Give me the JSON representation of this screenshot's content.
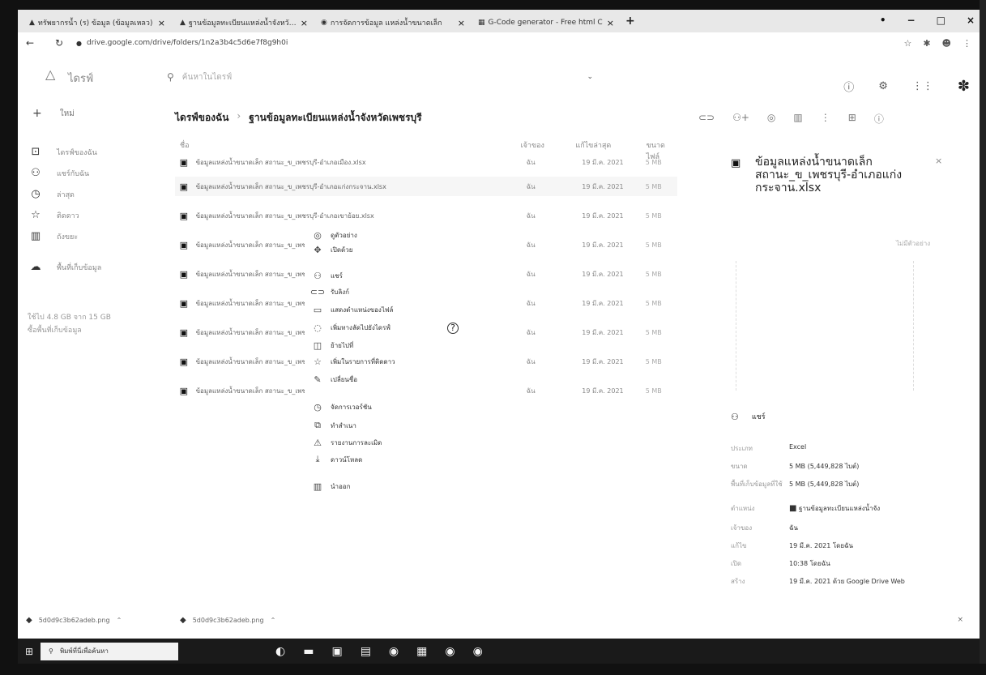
{
  "browser": {
    "tabs": [
      {
        "title": "ทรัพยากรน้ำ (ร) ข้อมูล (ข้อมูลเหลว)",
        "icon": "drive-icon"
      },
      {
        "title": "ฐานข้อมูลทะเบียนแหล่งน้ำจังหวัดเพชรบุรี",
        "icon": "drive-icon"
      },
      {
        "title": "การจัดการข้อมูล แหล่งน้ำขนาดเล็ก",
        "icon": "globe-icon"
      },
      {
        "title": "G-Code generator - Free html C",
        "icon": "sheet-icon"
      }
    ],
    "tab_close": "×",
    "new_tab": "+",
    "url": "drive.google.com/drive/folders/1n2a3b4c5d6e7f8g9h0i",
    "window_controls": [
      "•",
      "−",
      "□",
      "×"
    ]
  },
  "drive": {
    "logo_text": "ไดรฟ์",
    "search_placeholder": "ค้นหาในไดรฟ์",
    "search_options": "⌄",
    "header_icons": [
      "help-icon",
      "settings-icon",
      "apps-icon",
      "account-avatar-icon"
    ]
  },
  "leftnav": {
    "new_label": "ใหม่",
    "items": [
      {
        "label": "ไดรฟ์ของฉัน",
        "icon": "my-drive-icon"
      },
      {
        "label": "แชร์กับฉัน",
        "icon": "shared-icon"
      },
      {
        "label": "ล่าสุด",
        "icon": "recent-icon"
      },
      {
        "label": "ติดดาว",
        "icon": "starred-icon"
      },
      {
        "label": "ถังขยะ",
        "icon": "trash-icon"
      },
      {
        "label": "พื้นที่เก็บข้อมูล",
        "icon": "storage-icon"
      }
    ],
    "storage_used": "ใช้ไป 4.8 GB จาก 15 GB",
    "storage_buy": "ซื้อพื้นที่เก็บข้อมูล"
  },
  "breadcrumb": {
    "root": "ไดรฟ์ของฉัน",
    "sep": "›",
    "current": "ฐานข้อมูลทะเบียนแหล่งน้ำจังหวัดเพชรบุรี"
  },
  "toolbar_icons": [
    "link-icon",
    "add-person-icon",
    "preview-icon",
    "delete-icon",
    "more-icon",
    "grid-view-icon",
    "info-icon"
  ],
  "filelist": {
    "header": {
      "name": "ชื่อ",
      "owner": "เจ้าของ",
      "modified": "แก้ไขล่าสุด",
      "size": "ขนาดไฟล์"
    },
    "rows": [
      {
        "name": "ข้อมูลแหล่งน้ำขนาดเล็ก สถานะ_ข_เพชรบุรี-อำเภอเมือง.xlsx",
        "owner": "ฉัน",
        "modified": "19 มี.ค. 2021",
        "size": "5 MB"
      },
      {
        "name": "ข้อมูลแหล่งน้ำขนาดเล็ก สถานะ_ข_เพชรบุรี-อำเภอแก่งกระจาน.xlsx",
        "owner": "ฉัน",
        "modified": "19 มี.ค. 2021",
        "size": "5 MB"
      },
      {
        "name": "ข้อมูลแหล่งน้ำขนาดเล็ก สถานะ_ข_เพชรบุรี-อำเภอเขาย้อย.xlsx",
        "owner": "ฉัน",
        "modified": "19 มี.ค. 2021",
        "size": "5 MB"
      },
      {
        "name": "ข้อมูลแหล่งน้ำขนาดเล็ก สถานะ_ข_เพชรบุรี-อำเภอชะอำ.xlsx",
        "owner": "ฉัน",
        "modified": "19 มี.ค. 2021",
        "size": "5 MB"
      },
      {
        "name": "ข้อมูลแหล่งน้ำขนาดเล็ก สถานะ_ข_เพชรบุรี-อำเภอท่ายาง.xlsx",
        "owner": "ฉัน",
        "modified": "19 มี.ค. 2021",
        "size": "5 MB"
      },
      {
        "name": "ข้อมูลแหล่งน้ำขนาดเล็ก สถานะ_ข_เพชรบุรี-อำเภอบ้านลาด.xlsx",
        "owner": "ฉัน",
        "modified": "19 มี.ค. 2021",
        "size": "5 MB"
      },
      {
        "name": "ข้อมูลแหล่งน้ำขนาดเล็ก สถานะ_ข_เพชรบุรี-อำเภอบ้านแหลม.xlsx",
        "owner": "ฉัน",
        "modified": "19 มี.ค. 2021",
        "size": "5 MB"
      },
      {
        "name": "ข้อมูลแหล่งน้ำขนาดเล็ก สถานะ_ข_เพชรบุรี-อำเภอหนองหญ้าปล้อง.xlsx",
        "owner": "ฉัน",
        "modified": "19 มี.ค. 2021",
        "size": "5 MB"
      },
      {
        "name": "ข้อมูลแหล่งน้ำขนาดเล็ก สถานะ_ข_เพชรบุรี-รวม.xlsx",
        "owner": "ฉัน",
        "modified": "19 มี.ค. 2021",
        "size": "5 MB"
      }
    ]
  },
  "context_menu": {
    "items": [
      {
        "label": "ดูตัวอย่าง",
        "icon": "preview-icon"
      },
      {
        "label": "เปิดด้วย",
        "icon": "open-with-icon"
      },
      {
        "label": "แชร์",
        "icon": "share-icon"
      },
      {
        "label": "รับลิงก์",
        "icon": "link-icon"
      },
      {
        "label": "แสดงตำแหน่งของไฟล์",
        "icon": "folder-icon"
      },
      {
        "label": "เพิ่มทางลัดไปยังไดรฟ์",
        "icon": "shortcut-icon",
        "help": "?"
      },
      {
        "label": "ย้ายไปที่",
        "icon": "move-icon"
      },
      {
        "label": "เพิ่มในรายการที่ติดดาว",
        "icon": "star-icon"
      },
      {
        "label": "เปลี่ยนชื่อ",
        "icon": "rename-icon"
      },
      {
        "label": "จัดการเวอร์ชัน",
        "icon": "versions-icon"
      },
      {
        "label": "ทำสำเนา",
        "icon": "copy-icon"
      },
      {
        "label": "รายงานการละเมิด",
        "icon": "report-icon"
      },
      {
        "label": "ดาวน์โหลด",
        "icon": "download-icon"
      },
      {
        "label": "นำออก",
        "icon": "trash-icon"
      }
    ]
  },
  "details": {
    "title": "ข้อมูลแหล่งน้ำขนาดเล็ก สถานะ_ข_เพชรบุรี-อำเภอแก่งกระจาน.xlsx",
    "close": "×",
    "preview_label": "ไม่มีตัวอย่าง",
    "section_label": "แชร์",
    "props": [
      {
        "key": "ประเภท",
        "value": "Excel"
      },
      {
        "key": "ขนาด",
        "value": "5 MB (5,449,828 ไบต์)"
      },
      {
        "key": "พื้นที่เก็บข้อมูลที่ใช้",
        "value": "5 MB (5,449,828 ไบต์)"
      },
      {
        "key": "ตำแหน่ง",
        "value": "ฐานข้อมูลทะเบียนแหล่งน้ำจัง"
      },
      {
        "key": "เจ้าของ",
        "value": "ฉัน"
      },
      {
        "key": "แก้ไข",
        "value": "19 มี.ค. 2021 โดยฉัน"
      },
      {
        "key": "เปิด",
        "value": "10:38 โดยฉัน"
      },
      {
        "key": "สร้าง",
        "value": "19 มี.ค. 2021 ด้วย Google Drive Web"
      }
    ]
  },
  "downloads": {
    "items": [
      {
        "name": "5d0d9c3b62adeb.png"
      },
      {
        "name": "5d0d9c3b62adeb.png"
      }
    ],
    "close": "×"
  },
  "taskbar": {
    "search_placeholder": "พิมพ์ที่นี่เพื่อค้นหา",
    "apps": [
      "edge-icon",
      "mail-icon",
      "explorer-icon",
      "store-icon",
      "chrome-icon",
      "photos-icon",
      "chrome-2-icon",
      "chrome-3-icon"
    ]
  }
}
